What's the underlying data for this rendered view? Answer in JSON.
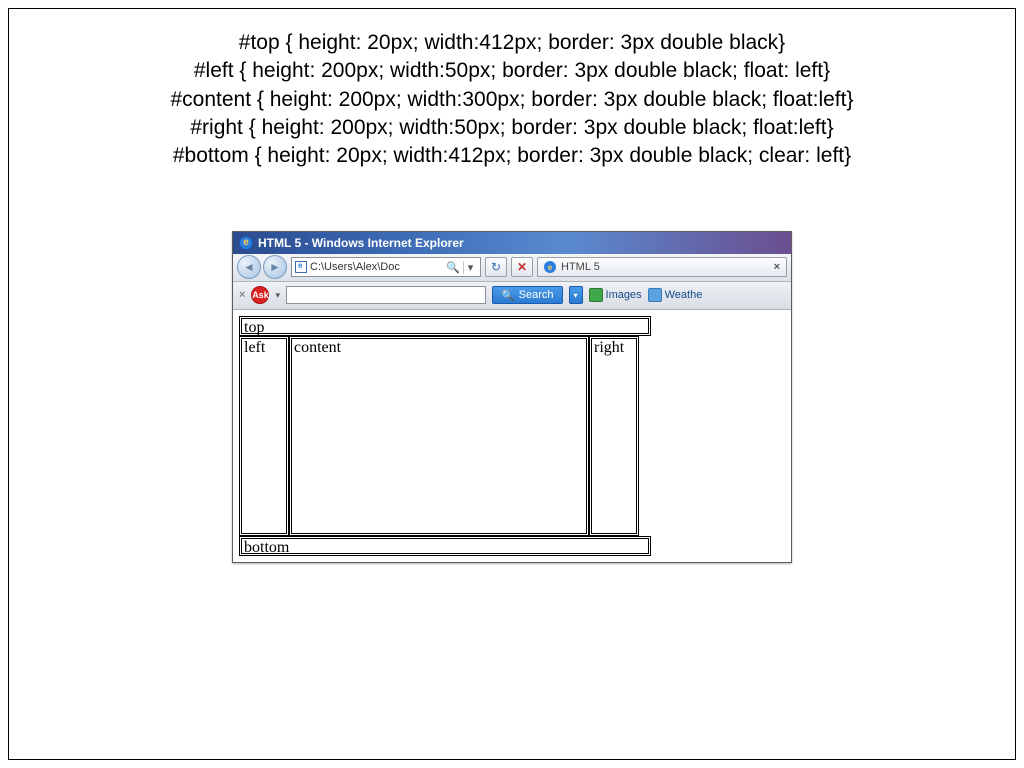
{
  "css_lines": [
    "#top { height: 20px; width:412px; border: 3px double black}",
    "#left { height: 200px; width:50px; border: 3px double black; float: left}",
    "#content { height: 200px; width:300px; border: 3px double black; float:left}",
    "#right { height: 200px; width:50px; border: 3px double black; float:left}",
    "#bottom { height: 20px; width:412px; border: 3px double black; clear: left}"
  ],
  "browser": {
    "title": "HTML 5 - Windows Internet Explorer",
    "address": "C:\\Users\\Alex\\Doc",
    "tab_label": "HTML 5",
    "tab_close": "×",
    "ask_label": "Ask",
    "search_label": "Search",
    "tb_images": "Images",
    "tb_weather": "Weathe"
  },
  "layout": {
    "top": "top",
    "left": "left",
    "content": "content",
    "right": "right",
    "bottom": "bottom"
  }
}
